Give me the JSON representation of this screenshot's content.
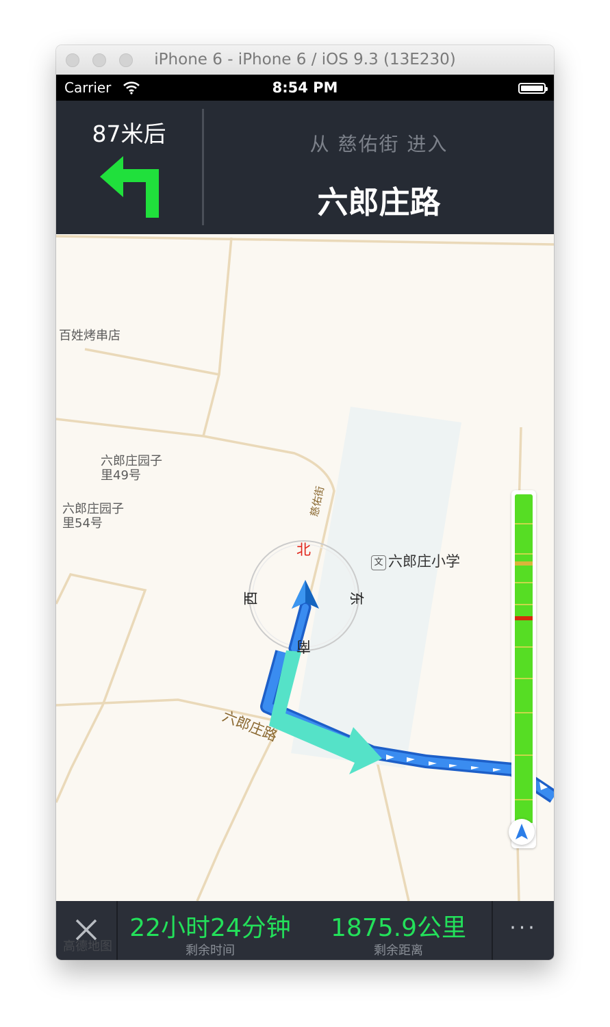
{
  "window": {
    "title": "iPhone 6 - iPhone 6 / iOS 9.3 (13E230)"
  },
  "statusbar": {
    "carrier": "Carrier",
    "time": "8:54 PM",
    "wifi_icon": "wifi-icon",
    "battery_icon": "battery-icon"
  },
  "nav": {
    "distance": "87米后",
    "turn_icon": "turn-left-arrow-icon",
    "from_text": "从 慈佑街 进入",
    "road_name": "六郎庄路",
    "arrow_color": "#20e03c"
  },
  "map": {
    "pois": {
      "bbq": "百姓烤串店",
      "yuanzi49_line1": "六郎庄园子",
      "yuanzi49_line2": "里49号",
      "yuanzi54_line1": "六郎庄园子",
      "yuanzi54_line2": "里54号",
      "school": "六郎庄小学",
      "school_icon_text": "文"
    },
    "roads": {
      "ciyou": "慈佑街",
      "liulangzhuang": "六郎庄路"
    },
    "compass": {
      "north": "北",
      "south": "南",
      "east": "东",
      "west": "西"
    },
    "route_color": "#2b7de8",
    "maneuver_color": "#55e2c8",
    "traffic_bar_color": "#56dd24"
  },
  "bottom": {
    "close_icon": "close-icon",
    "remaining_time": "22小时24分钟",
    "remaining_time_label": "剩余时间",
    "remaining_distance": "1875.9公里",
    "remaining_distance_label": "剩余距离",
    "more_label": "···",
    "watermark": "高德地图"
  }
}
